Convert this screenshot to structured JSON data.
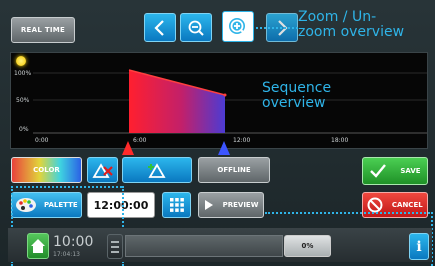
{
  "toolbar": {
    "realtime_label": "REAL TIME",
    "back_icon": "chevron-left-icon",
    "zoom_out_icon": "zoom-out-icon",
    "zoom_in_icon": "zoom-in-icon",
    "forward_icon": "chevron-right-icon"
  },
  "annotations": {
    "zoom": "Zoom / Un-\nzoom overview",
    "sequence": "Sequence\noverview"
  },
  "chart": {
    "y_ticks": [
      "100%",
      "50%",
      "0%"
    ],
    "x_ticks": [
      "0:00",
      "6:00",
      "12:00",
      "18:00"
    ]
  },
  "controls": {
    "color_label": "COLOR",
    "offline_label": "OFFLINE",
    "save_label": "SAVE",
    "palette_label": "PALETTE",
    "time_value": "12:00:00",
    "preview_label": "PREVIEW",
    "cancel_label": "CANCEL"
  },
  "status": {
    "clock": "10:00",
    "date": "17:04:13",
    "percent": "0%"
  },
  "colors": {
    "accent": "#2fb4e8",
    "save_green": "#2fb33a",
    "cancel_red": "#e02424"
  }
}
